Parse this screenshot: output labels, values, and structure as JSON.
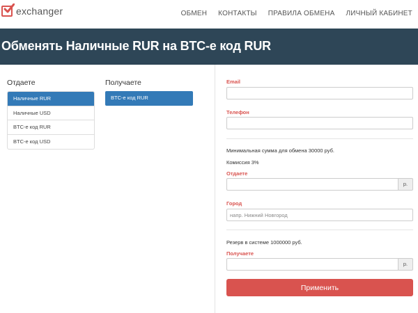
{
  "header": {
    "logo_text": "exchanger",
    "nav": [
      "ОБМЕН",
      "КОНТАКТЫ",
      "ПРАВИЛА ОБМЕНА",
      "ЛИЧНЫЙ КАБИНЕТ"
    ]
  },
  "title": "Обменять Наличные RUR на BTC-e код RUR",
  "give": {
    "heading": "Отдаете",
    "items": [
      "Наличные RUR",
      "Наличные USD",
      "BTC-e код RUR",
      "BTC-e код USD"
    ],
    "selected": "Наличные RUR"
  },
  "receive": {
    "heading": "Получаете",
    "items": [
      "BTC-e код RUR"
    ],
    "selected": "BTC-e код RUR"
  },
  "form": {
    "email_label": "Email",
    "email_value": "",
    "phone_label": "Телефон",
    "phone_value": "",
    "min_text": "Минимальная сумма для обмена 30000 руб.",
    "fee_text": "Комиссия 3%",
    "give_label": "Отдаете",
    "give_value": "",
    "currency_suffix": "р.",
    "city_label": "Город",
    "city_placeholder": "напр. Нижний Новгород",
    "reserve_text": "Резерв в системе 1000000 руб.",
    "receive_label": "Получаете",
    "receive_value": "",
    "submit_label": "Применить"
  },
  "colors": {
    "accent": "#d9534f",
    "primary": "#337ab7",
    "band": "#2e4657"
  },
  "icons": {
    "logo": "checkbox-check-icon"
  }
}
